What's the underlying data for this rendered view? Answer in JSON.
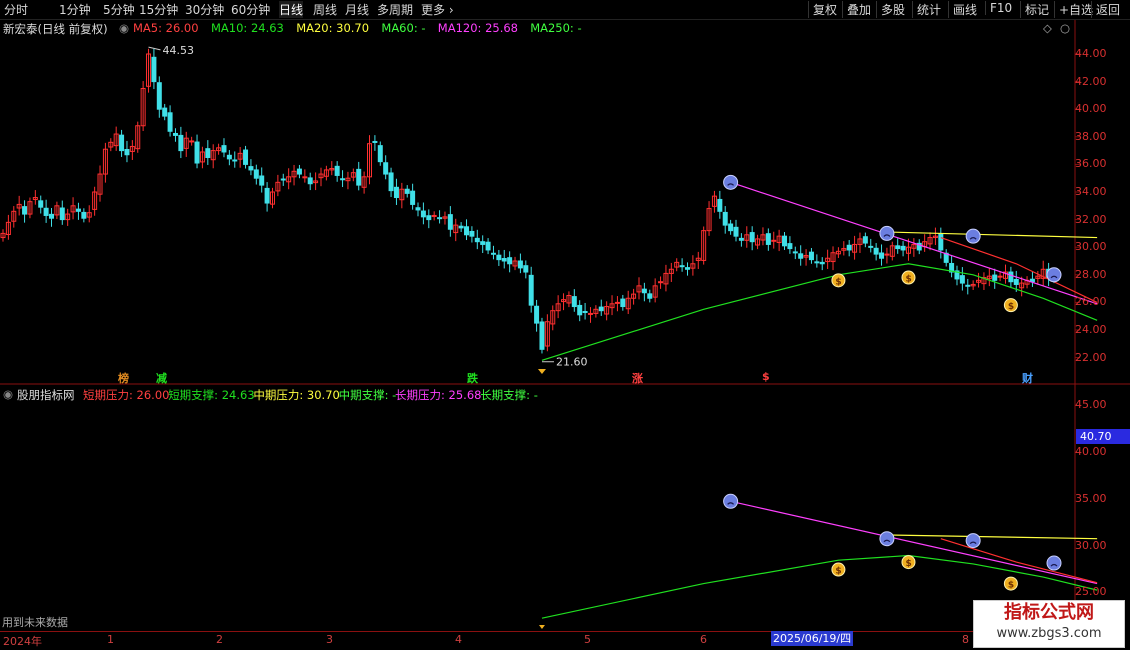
{
  "toolbar": {
    "left": [
      {
        "label": "分时",
        "active": false
      },
      {
        "label": "1分钟",
        "active": false
      },
      {
        "label": "5分钟",
        "active": false
      },
      {
        "label": "15分钟",
        "active": false
      },
      {
        "label": "30分钟",
        "active": false
      },
      {
        "label": "60分钟",
        "active": false
      },
      {
        "label": "日线",
        "active": true
      },
      {
        "label": "周线",
        "active": false
      },
      {
        "label": "月线",
        "active": false
      },
      {
        "label": "多周期",
        "active": false
      },
      {
        "label": "更多",
        "active": false
      }
    ],
    "right": [
      "复权",
      "叠加",
      "多股",
      "统计",
      "画线",
      "F10",
      "标记",
      "+自选",
      "返回"
    ]
  },
  "main_chart": {
    "title": "新宏泰(日线 前复权)",
    "ma_legend": [
      {
        "label": "MA5: 26.00",
        "color": "#ff4040"
      },
      {
        "label": "MA10: 24.63",
        "color": "#20e020"
      },
      {
        "label": "MA20: 30.70",
        "color": "#ffff40"
      },
      {
        "label": "MA60: -",
        "color": "#40ff40"
      },
      {
        "label": "MA120: 25.68",
        "color": "#ff40ff"
      },
      {
        "label": "MA250: -",
        "color": "#40ff40"
      }
    ],
    "y_ticks": [
      "44.00",
      "42.00",
      "40.00",
      "38.00",
      "36.00",
      "34.00",
      "32.00",
      "30.00",
      "28.00",
      "26.00",
      "24.00",
      "22.00"
    ],
    "high_label": "44.53",
    "low_label": "21.60",
    "event_markers": [
      {
        "text": "榜",
        "color": "#e08a20"
      },
      {
        "text": "减",
        "color": "#20e020"
      },
      {
        "text": "跌",
        "color": "#20e020"
      },
      {
        "text": "涨",
        "color": "#ff4040"
      },
      {
        "text": "$",
        "color": "#ff4040"
      },
      {
        "text": "财",
        "color": "#4aa0ff"
      }
    ]
  },
  "sub_chart": {
    "title": "股朋指标网",
    "legend": [
      {
        "label": "短期压力: 26.00",
        "color": "#ff4040"
      },
      {
        "label": "短期支撑: 24.63",
        "color": "#20e020"
      },
      {
        "label": "中期压力: 30.70",
        "color": "#ffff40"
      },
      {
        "label": "中期支撑: -",
        "color": "#40ff40"
      },
      {
        "label": "长期压力: 25.68",
        "color": "#ff40ff"
      },
      {
        "label": "长期支撑: -",
        "color": "#40ff40"
      }
    ],
    "y_ticks": [
      "45.00",
      "40.00",
      "35.00",
      "30.00",
      "25.00"
    ],
    "current_value": "40.70",
    "future_data_text": "用到未来数据"
  },
  "date_axis": {
    "labels": [
      "2024年",
      "1",
      "2",
      "3",
      "4",
      "5",
      "6",
      "8"
    ],
    "highlight": "2025/06/19/四"
  },
  "watermark": {
    "line1": "指标公式网",
    "line2": "www.zbgs3.com"
  },
  "chart_data": {
    "type": "candlestick",
    "title": "新宏泰(日线 前复权)",
    "ylim": [
      21,
      45
    ],
    "close": [
      31,
      31.8,
      32.6,
      33.1,
      32.4,
      33.3,
      33.6,
      32.9,
      32.3,
      32.1,
      33,
      32,
      32.4,
      33,
      32.6,
      32.1,
      32.5,
      34,
      35.3,
      37.1,
      37.6,
      38.2,
      37,
      36.7,
      37.3,
      38.8,
      41.5,
      44,
      42,
      40,
      39.5,
      38.4,
      38.1,
      37,
      37.9,
      37.7,
      36.1,
      36.9,
      36.5,
      37,
      37.2,
      36.9,
      36.4,
      36.3,
      36.8,
      36,
      35.6,
      35,
      34.5,
      33.2,
      34,
      34.7,
      34.9,
      35.1,
      35.5,
      35.3,
      35.1,
      34.6,
      34.8,
      35.3,
      35.6,
      35.7,
      35.2,
      34.9,
      35,
      35.4,
      34.5,
      35.1,
      37.5,
      37.6,
      36.2,
      35.3,
      34.1,
      33.6,
      34.2,
      33.9,
      33.1,
      32.7,
      32.2,
      32,
      32.3,
      32.1,
      32.2,
      31.3,
      31.6,
      31.4,
      30.9,
      30.8,
      30.4,
      30.2,
      29.8,
      29.5,
      29.1,
      29,
      28.8,
      29,
      28.5,
      28.2,
      25.8,
      24.5,
      22.6,
      24.6,
      25.4,
      25.9,
      26.2,
      26.5,
      25.7,
      25.1,
      25.3,
      25.2,
      25.5,
      25.4,
      25.7,
      25.9,
      26,
      25.7,
      26.3,
      26.6,
      27.2,
      26.7,
      26.3,
      27.2,
      27.5,
      28.1,
      28.4,
      28.9,
      28.6,
      28.4,
      28.8,
      29.2,
      31.2,
      32.8,
      33.7,
      32.6,
      31.6,
      31.2,
      30.8,
      30.5,
      30.9,
      30.4,
      30.6,
      30.9,
      30.2,
      30.5,
      30.8,
      30.1,
      29.9,
      29.6,
      29.2,
      29.4,
      29.1,
      28.9,
      28.8,
      29.2,
      29.6,
      29.7,
      29.9,
      29.8,
      30.2,
      30.6,
      30.3,
      30,
      29.5,
      29.2,
      29.5,
      30.1,
      29.9,
      29.8,
      30,
      30.2,
      29.8,
      30.4,
      30.7,
      30.8,
      29.8,
      28.9,
      28.2,
      27.7,
      27.4,
      27.2,
      27.3,
      27.6,
      27.8,
      27.9,
      27.6,
      27.9,
      28.2,
      27.5,
      27.3,
      27.4,
      27.6,
      27.5,
      27.9,
      28.4,
      27.8,
      27.7
    ]
  }
}
